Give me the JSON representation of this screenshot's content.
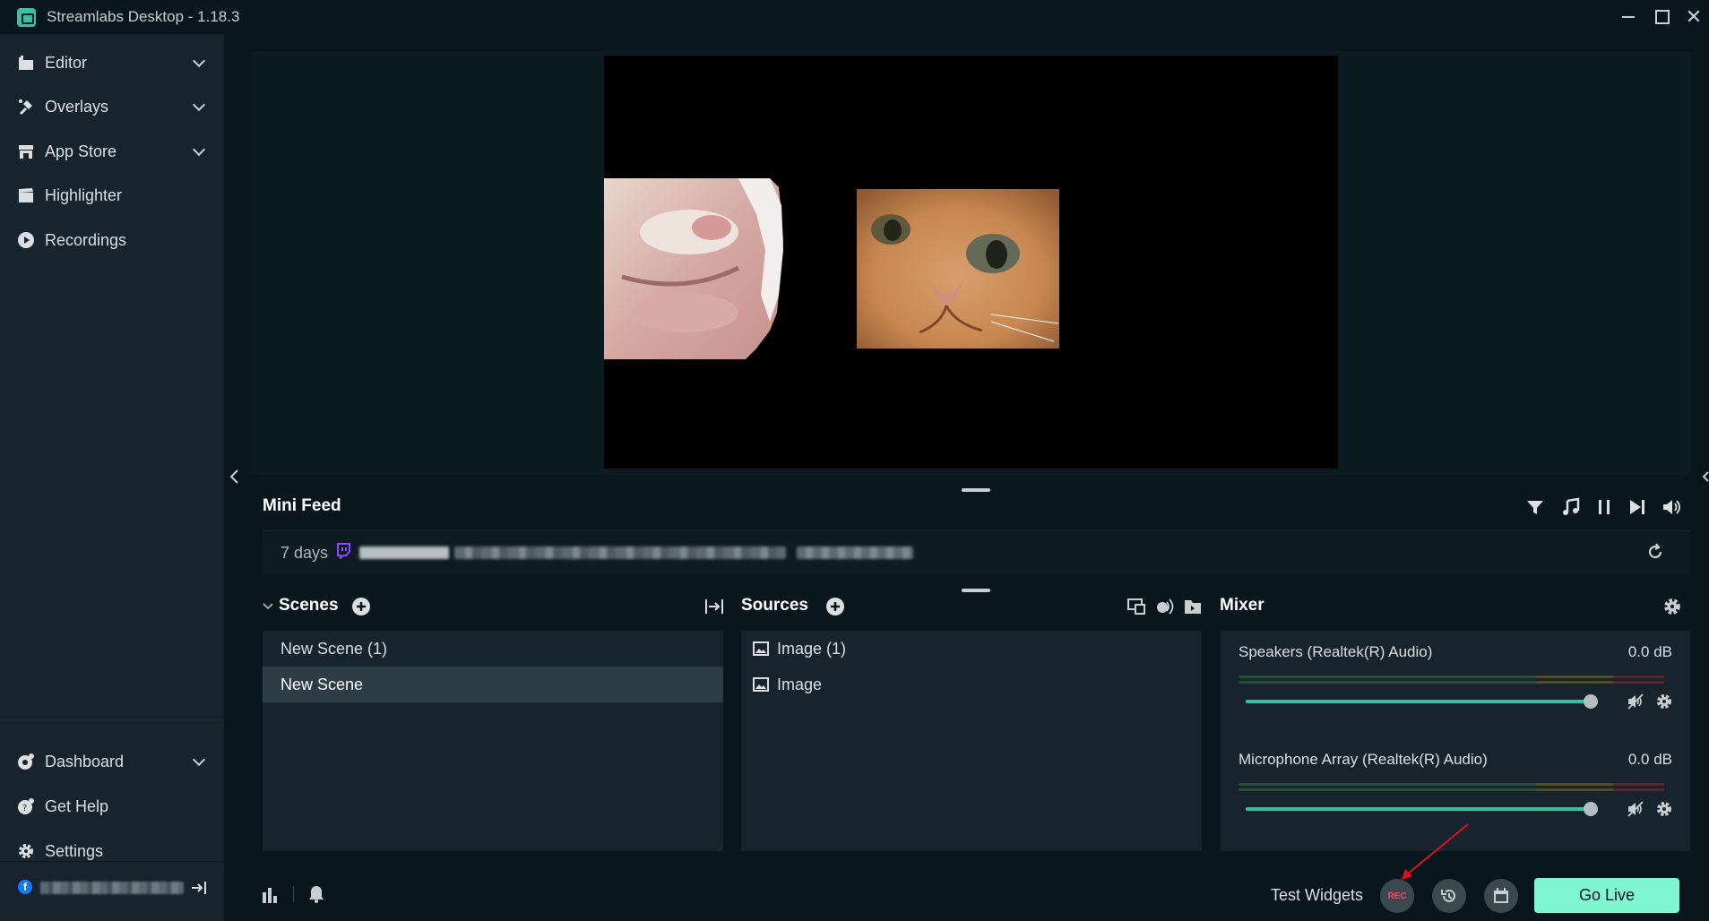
{
  "window": {
    "title": "Streamlabs Desktop - 1.18.3"
  },
  "sidebar": {
    "items": [
      {
        "label": "Editor",
        "icon": "editor-icon",
        "expandable": true
      },
      {
        "label": "Overlays",
        "icon": "overlays-icon",
        "expandable": true
      },
      {
        "label": "App Store",
        "icon": "store-icon",
        "expandable": true
      },
      {
        "label": "Highlighter",
        "icon": "highlighter-icon",
        "expandable": false
      },
      {
        "label": "Recordings",
        "icon": "play-circle-icon",
        "expandable": false
      }
    ],
    "bottom_items": [
      {
        "label": "Dashboard",
        "icon": "dashboard-icon",
        "expandable": true
      },
      {
        "label": "Get Help",
        "icon": "help-icon",
        "expandable": false
      },
      {
        "label": "Settings",
        "icon": "gear-icon",
        "expandable": false
      }
    ],
    "account_platform_icon": "facebook-icon"
  },
  "mini_feed": {
    "title": "Mini Feed",
    "event_time": "7 days",
    "platform_icon": "twitch-icon"
  },
  "scenes": {
    "title": "Scenes",
    "items": [
      {
        "label": "New Scene (1)",
        "selected": false
      },
      {
        "label": "New Scene",
        "selected": true
      }
    ]
  },
  "sources": {
    "title": "Sources",
    "items": [
      {
        "label": "Image (1)"
      },
      {
        "label": "Image"
      }
    ]
  },
  "mixer": {
    "title": "Mixer",
    "tracks": [
      {
        "name": "Speakers (Realtek(R) Audio)",
        "db": "0.0 dB",
        "volume": 1.0
      },
      {
        "name": "Microphone Array (Realtek(R) Audio)",
        "db": "0.0 dB",
        "volume": 1.0
      }
    ]
  },
  "footer": {
    "test_widgets": "Test Widgets",
    "rec_label": "REC",
    "go_live": "Go Live"
  },
  "colors": {
    "accent": "#31c3a2",
    "go_live_bg": "#80f5d2",
    "rec": "#f24a5c",
    "twitch": "#9146ff",
    "annotation_arrow": "#e0101b"
  }
}
